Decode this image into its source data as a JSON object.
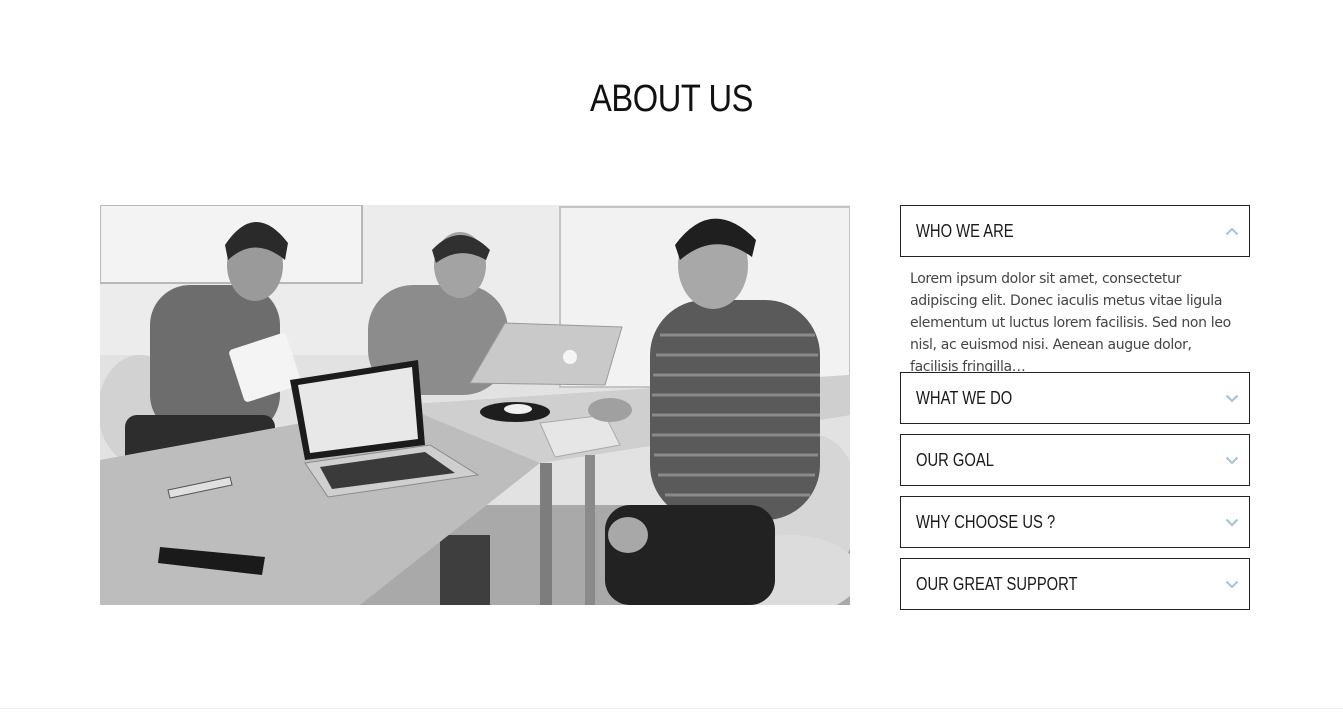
{
  "section": {
    "title": "ABOUT US"
  },
  "accordion": {
    "items": [
      {
        "title": "WHO WE ARE",
        "expanded": true,
        "icon": "chevron-up-icon",
        "body": "Lorem ipsum dolor sit amet, consectetur adipiscing elit. Donec iaculis metus vitae ligula elementum ut luctus lorem facilisis. Sed non leo nisl, ac euismod nisi. Aenean augue dolor, facilisis fringilla…"
      },
      {
        "title": "WHAT WE DO",
        "expanded": false,
        "icon": "chevron-down-icon"
      },
      {
        "title": "OUR GOAL",
        "expanded": false,
        "icon": "chevron-down-icon"
      },
      {
        "title": "WHY CHOOSE US ?",
        "expanded": false,
        "icon": "chevron-down-icon"
      },
      {
        "title": "OUR GREAT SUPPORT",
        "expanded": false,
        "icon": "chevron-down-icon"
      }
    ]
  },
  "colors": {
    "chevron": "#9fc3d4",
    "border": "#222222",
    "text": "#1a1a1a",
    "body_text": "#444444"
  }
}
